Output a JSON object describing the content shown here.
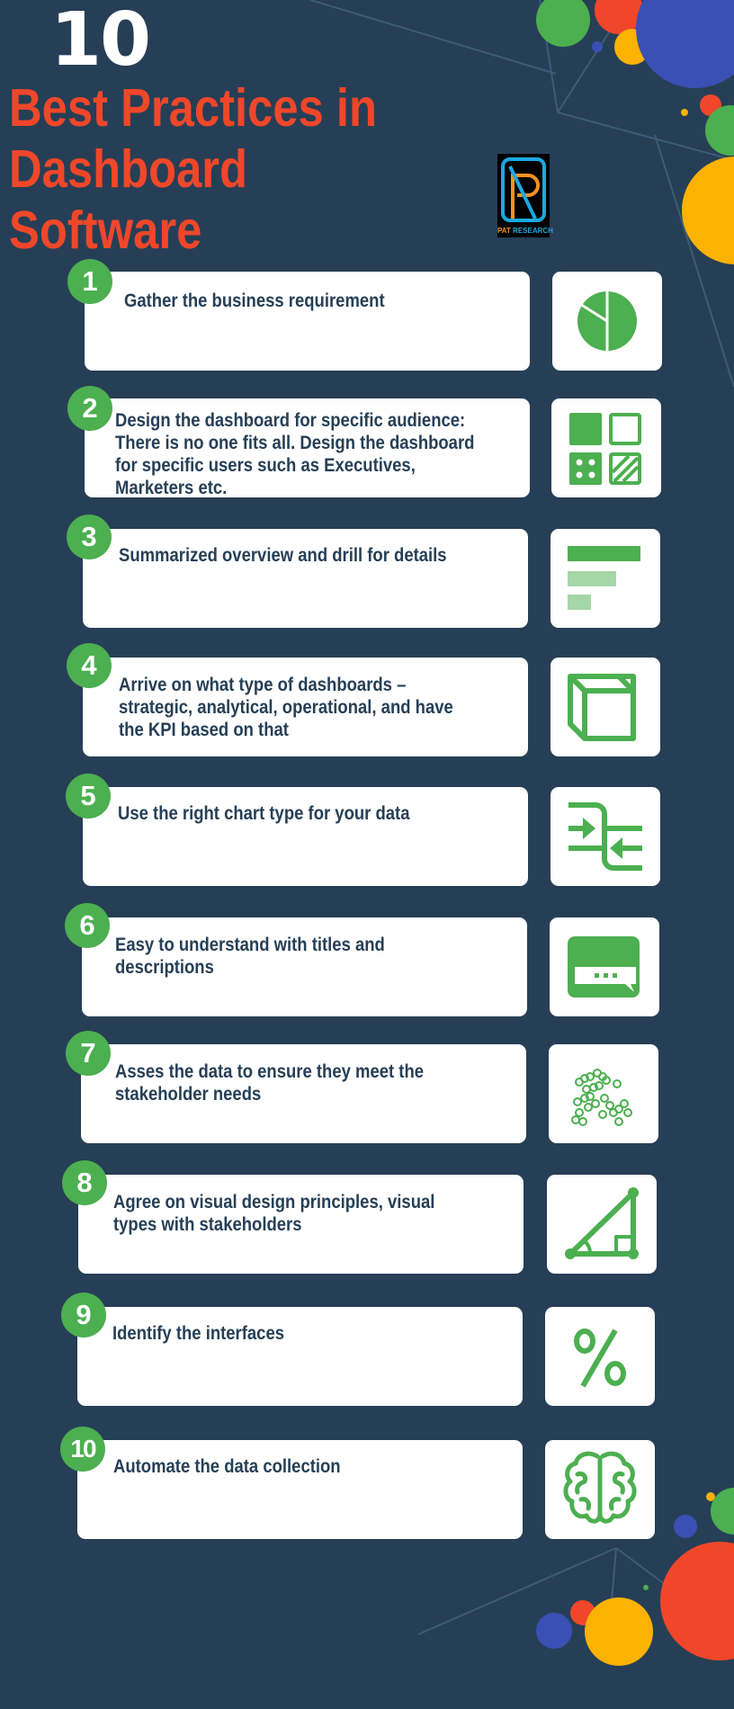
{
  "header": {
    "number": "10",
    "title_line1": "Best Practices in Dashboard",
    "title_line2": "Software"
  },
  "logo": {
    "brand_part1": "PAT",
    "brand_part2": "RESEARCH",
    "letter": "PR"
  },
  "colors": {
    "background": "#263f56",
    "accent_red": "#f0472a",
    "accent_green": "#4caf50",
    "accent_yellow": "#fbb202",
    "accent_blue": "#3a50b5",
    "card": "#ffffff",
    "text": "#263f56"
  },
  "practices": [
    {
      "number": "1",
      "text": "Gather the business requirement",
      "icon": "pie-chart-icon"
    },
    {
      "number": "2",
      "text": "Design the dashboard for specific audience: There is no one fits all. Design the dashboard for specific users such as Executives, Marketers etc.",
      "icon": "grid-tiles-icon"
    },
    {
      "number": "3",
      "text": "Summarized overview and drill for details",
      "icon": "horizontal-bars-icon"
    },
    {
      "number": "4",
      "text": "Arrive on what type of dashboards – strategic, analytical, operational, and have the KPI based on that",
      "icon": "cube-icon"
    },
    {
      "number": "5",
      "text": "Use the right chart type for your data",
      "icon": "merge-arrows-icon"
    },
    {
      "number": "6",
      "text": "Easy to understand with titles and descriptions",
      "icon": "chat-bubble-icon"
    },
    {
      "number": "7",
      "text": "Asses the data to ensure they meet the stakeholder needs",
      "icon": "scatter-dots-icon"
    },
    {
      "number": "8",
      "text": "Agree on visual design principles, visual types with stakeholders",
      "icon": "right-triangle-icon"
    },
    {
      "number": "9",
      "text": "Identify the interfaces",
      "icon": "percent-icon"
    },
    {
      "number": "10",
      "text": "Automate the data collection",
      "icon": "brain-icon"
    }
  ]
}
